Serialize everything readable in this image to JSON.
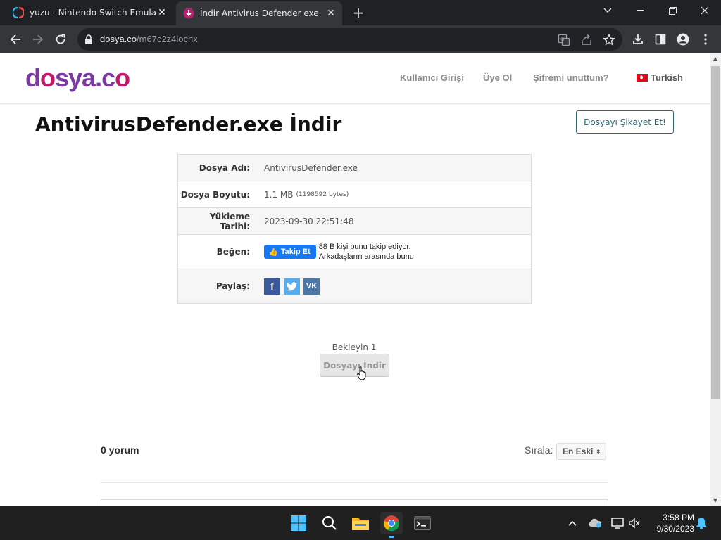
{
  "browser": {
    "tabs": [
      {
        "title": "yuzu - Nintendo Switch Emulator",
        "active": false,
        "icon": "yuzu-icon"
      },
      {
        "title": "İndir Antivirus Defender exe",
        "active": true,
        "icon": "dosya-icon"
      }
    ],
    "url_host": "dosya.co",
    "url_path": "/m67c2z4lochx"
  },
  "site": {
    "logo_main": "d",
    "logo_o": "o",
    "logo_rest": "sya.c",
    "logo_end": "o",
    "nav": {
      "login": "Kullanıcı Girişi",
      "register": "Üye Ol",
      "forgot": "Şifremi unuttum?",
      "language": "Turkish"
    }
  },
  "page": {
    "title": "AntivirusDefender.exe İndir",
    "report_button": "Dosyayı Şikayet Et!",
    "info": {
      "name_label": "Dosya Adı:",
      "name_value": "AntivirusDefender.exe",
      "size_label": "Dosya Boyutu:",
      "size_value": "1.1 MB",
      "size_bytes": "(1198592 bytes)",
      "date_label": "Yükleme Tarihi:",
      "date_value": "2023-09-30 22:51:48",
      "like_label": "Beğen:",
      "fb_button": "Takip Et",
      "fb_line1": "88 B kişi bunu takip ediyor.",
      "fb_line2": "Arkadaşların arasında bunu",
      "share_label": "Paylaş:"
    },
    "wait_text": "Bekleyin 1",
    "download_button": "Dosyayı İndir"
  },
  "comments": {
    "count": "0 yorum",
    "sort_label": "Sırala:",
    "sort_value": "En Eski"
  },
  "taskbar": {
    "time": "3:58 PM",
    "date": "9/30/2023"
  },
  "colors": {
    "logo_purple": "#7a3aa2",
    "logo_pink": "#c0186c",
    "report_border": "#2a6a74",
    "facebook": "#3b5998",
    "twitter": "#55acee",
    "vk": "#4a76a8"
  }
}
